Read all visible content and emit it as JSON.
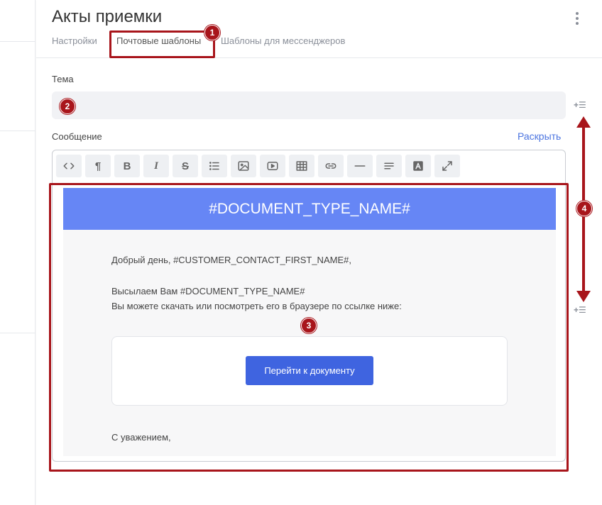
{
  "header": {
    "title": "Акты приемки"
  },
  "tabs": [
    {
      "label": "Настройки"
    },
    {
      "label": "Почтовые шаблоны"
    },
    {
      "label": "Шаблоны для мессенджеров"
    }
  ],
  "form": {
    "subject_label": "Тема",
    "subject_value": "",
    "message_label": "Сообщение",
    "expand_label": "Раскрыть"
  },
  "toolbar": {
    "tools": [
      "code-icon",
      "paragraph-icon",
      "bold-icon",
      "italic-icon",
      "strikethrough-icon",
      "list-icon",
      "image-icon",
      "video-icon",
      "table-icon",
      "link-icon",
      "horizontal-rule-icon",
      "align-icon",
      "font-color-icon",
      "fullscreen-icon"
    ]
  },
  "email": {
    "header": "#DOCUMENT_TYPE_NAME#",
    "greeting": "Добрый день, #CUSTOMER_CONTACT_FIRST_NAME#,",
    "line1": "Высылаем Вам #DOCUMENT_TYPE_NAME#",
    "line2": "Вы можете скачать или посмотреть его в браузере по ссылке ниже:",
    "button": "Перейти к документу",
    "signoff": "С уважением,"
  },
  "annotations": {
    "badges": [
      "1",
      "2",
      "3",
      "4"
    ],
    "color": "#a8151b"
  },
  "colors": {
    "accent": "#4b74e0",
    "email_header": "#6686f5",
    "button": "#3f64e0"
  }
}
